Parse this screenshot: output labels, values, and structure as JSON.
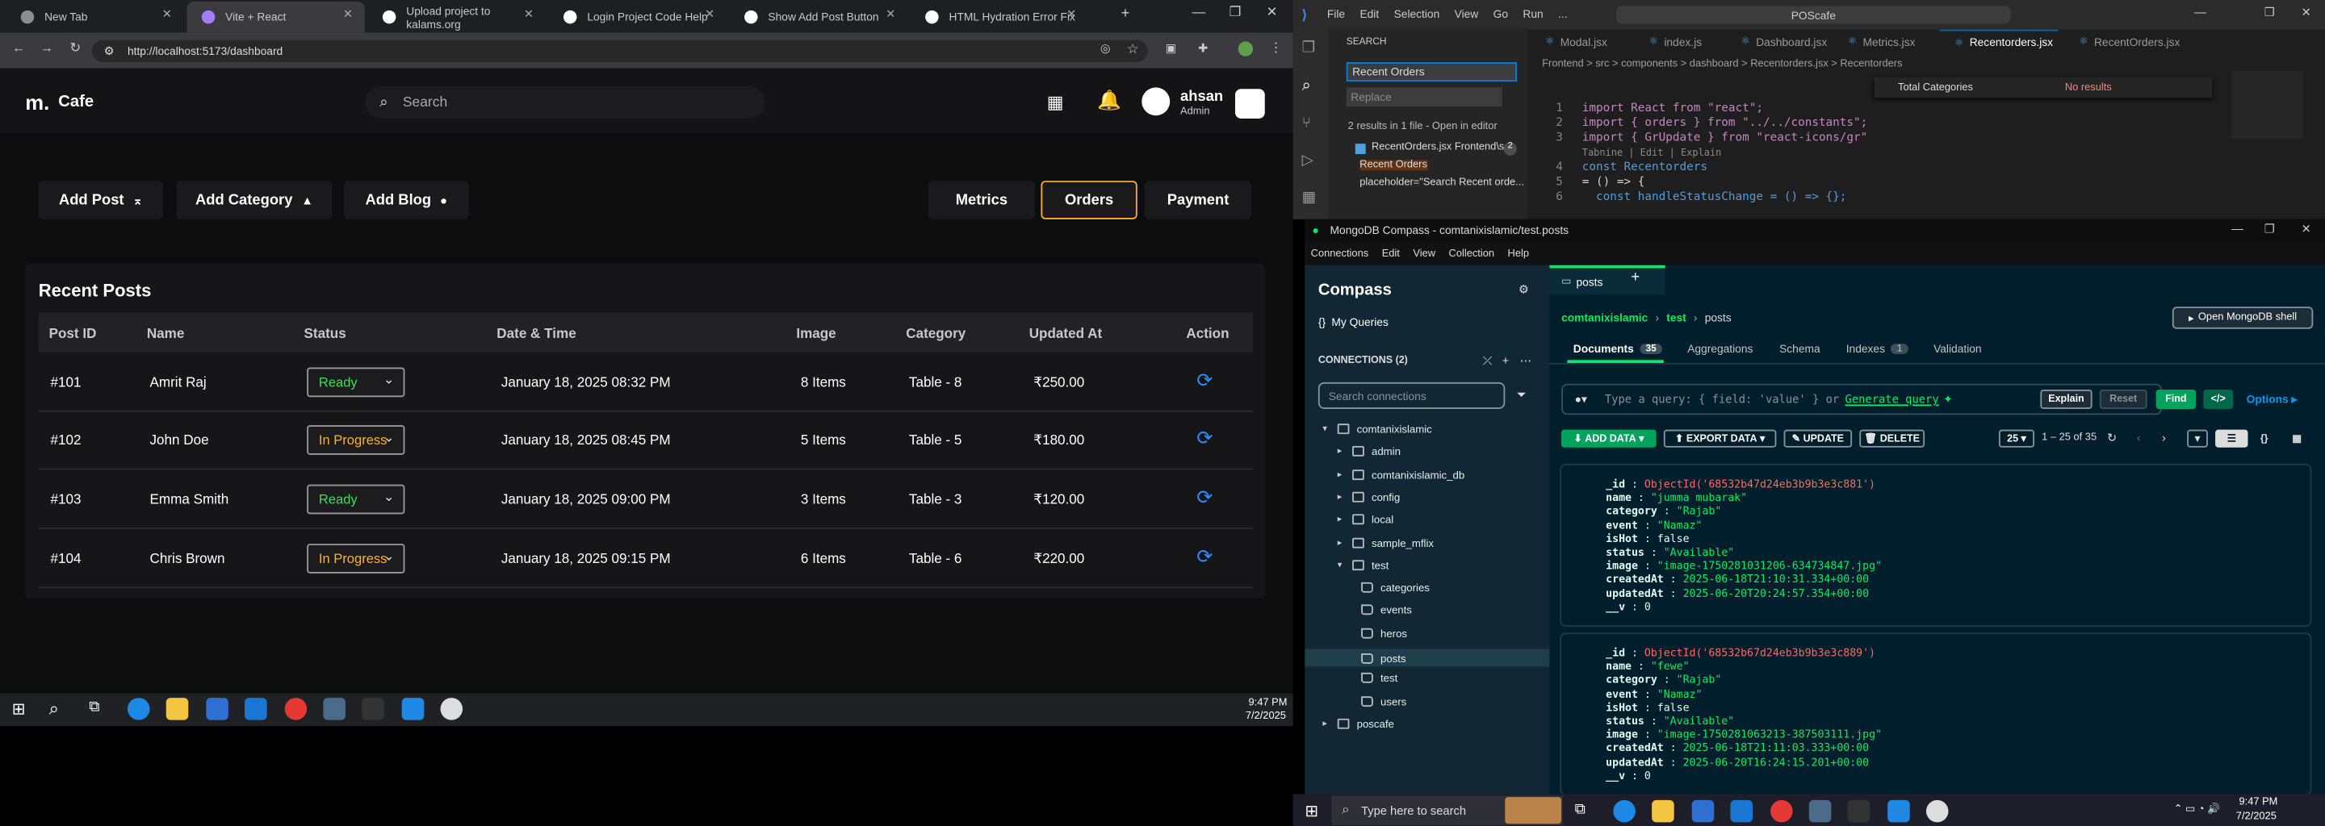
{
  "chrome": {
    "tabs": [
      "New Tab",
      "Vite + React",
      "Upload project to kalams.org",
      "Login Project Code Help",
      "Show Add Post Button",
      "HTML Hydration Error Fix"
    ],
    "url": "http://localhost:5173/dashboard"
  },
  "app": {
    "brand": "Cafe",
    "search_placeholder": "Search",
    "user_name": "ahsan",
    "user_role": "Admin",
    "buttons": {
      "add_post": "Add Post",
      "add_category": "Add Category",
      "add_blog": "Add Blog"
    },
    "tabs": [
      "Metrics",
      "Orders",
      "Payment"
    ],
    "section_title": "Recent Posts",
    "columns": [
      "Post ID",
      "Name",
      "Status",
      "Date & Time",
      "Image",
      "Category",
      "Updated At",
      "Action"
    ],
    "rows": [
      {
        "id": "#101",
        "name": "Amrit Raj",
        "status": "Ready",
        "datetime": "January 18, 2025 08:32 PM",
        "image": "8 Items",
        "category": "Table - 8",
        "updated": "₹250.00"
      },
      {
        "id": "#102",
        "name": "John Doe",
        "status": "In Progress",
        "datetime": "January 18, 2025 08:45 PM",
        "image": "5 Items",
        "category": "Table - 5",
        "updated": "₹180.00"
      },
      {
        "id": "#103",
        "name": "Emma Smith",
        "status": "Ready",
        "datetime": "January 18, 2025 09:00 PM",
        "image": "3 Items",
        "category": "Table - 3",
        "updated": "₹120.00"
      },
      {
        "id": "#104",
        "name": "Chris Brown",
        "status": "In Progress",
        "datetime": "January 18, 2025 09:15 PM",
        "image": "6 Items",
        "category": "Table - 6",
        "updated": "₹220.00"
      }
    ],
    "status_colors": {
      "Ready": "#3ddc5c",
      "In Progress": "#ffb02e"
    }
  },
  "taskbar_left": {
    "time": "9:47 PM",
    "date": "7/2/2025"
  },
  "vscode": {
    "menu": [
      "File",
      "Edit",
      "Selection",
      "View",
      "Go",
      "Run",
      "..."
    ],
    "title_search": "POScafe",
    "tabs": [
      "Modal.jsx",
      "index.js",
      "Dashboard.jsx",
      "Metrics.jsx",
      "Recentorders.jsx",
      "RecentOrders.jsx"
    ],
    "breadcrumb": "Frontend > src > components > dashboard > Recentorders.jsx > Recentorders",
    "search_label": "SEARCH",
    "search_value": "Recent Orders",
    "replace_placeholder": "Replace",
    "results": "2 results in 1 file - Open in editor",
    "result_file": "RecentOrders.jsx  Frontend\\s...",
    "result_count": "2",
    "match1": "Recent Orders",
    "match2": "placeholder=\"Search Recent orde...",
    "find_value": "Total Categories",
    "find_status": "No results",
    "code_lines": [
      "import React from \"react\";",
      "import { orders } from \"../../constants\";",
      "import { GrUpdate } from \"react-icons/gr\"",
      "Tabnine | Edit | Explain",
      "const Recentorders",
      "= () => {",
      "  const handleStatusChange = () => {};"
    ],
    "line_numbers": [
      "1",
      "2",
      "3",
      "4",
      "5",
      "6"
    ]
  },
  "compass": {
    "title": "MongoDB Compass - comtanixislamic/test.posts",
    "menu": [
      "Connections",
      "Edit",
      "View",
      "Collection",
      "Help"
    ],
    "brand": "Compass",
    "my_queries": "My Queries",
    "connections_label": "CONNECTIONS (2)",
    "search_connections": "Search connections",
    "tree": [
      {
        "label": "comtanixislamic",
        "level": 0,
        "open": true
      },
      {
        "label": "admin",
        "level": 1
      },
      {
        "label": "comtanixislamic_db",
        "level": 1
      },
      {
        "label": "config",
        "level": 1
      },
      {
        "label": "local",
        "level": 1
      },
      {
        "label": "sample_mflix",
        "level": 1
      },
      {
        "label": "test",
        "level": 1,
        "open": true
      },
      {
        "label": "categories",
        "level": 2
      },
      {
        "label": "events",
        "level": 2
      },
      {
        "label": "heros",
        "level": 2
      },
      {
        "label": "posts",
        "level": 2,
        "selected": true
      },
      {
        "label": "test",
        "level": 2
      },
      {
        "label": "users",
        "level": 2
      },
      {
        "label": "poscafe",
        "level": 0
      }
    ],
    "tab_label": "posts",
    "breadcrumb": [
      "comtanixislamic",
      "test",
      "posts"
    ],
    "open_shell": "Open MongoDB shell",
    "subtabs": [
      {
        "label": "Documents",
        "count": "35"
      },
      {
        "label": "Aggregations"
      },
      {
        "label": "Schema"
      },
      {
        "label": "Indexes",
        "count": "1"
      },
      {
        "label": "Validation"
      }
    ],
    "query_placeholder": "Type a query: { field: 'value' } or",
    "generate_query": "Generate query",
    "explain": "Explain",
    "reset": "Reset",
    "find": "Find",
    "options": "Options",
    "add_data": "ADD DATA",
    "export_data": "EXPORT DATA",
    "update": "UPDATE",
    "delete": "DELETE",
    "page_size": "25",
    "range": "1 – 25 of 35",
    "docs": [
      {
        "_id": "ObjectId('68532b47d24eb3b9b3e3c881')",
        "name": "\"jumma mubarak\"",
        "category": "\"Rajab\"",
        "event": "\"Namaz\"",
        "isHot": "false",
        "status": "\"Available\"",
        "image": "\"image-1750281031206-634734847.jpg\"",
        "createdAt": "2025-06-18T21:10:31.334+00:00",
        "updatedAt": "2025-06-20T20:24:57.354+00:00",
        "__v": "0"
      },
      {
        "_id": "ObjectId('68532b67d24eb3b9b3e3c889')",
        "name": "\"fewe\"",
        "category": "\"Rajab\"",
        "event": "\"Namaz\"",
        "isHot": "false",
        "status": "\"Available\"",
        "image": "\"image-1750281063213-387503111.jpg\"",
        "createdAt": "2025-06-18T21:11:03.333+00:00",
        "updatedAt": "2025-06-20T16:24:15.201+00:00",
        "__v": "0"
      }
    ]
  },
  "wintask": {
    "search": "Type here to search",
    "time": "9:47 PM",
    "date": "7/2/2025"
  }
}
